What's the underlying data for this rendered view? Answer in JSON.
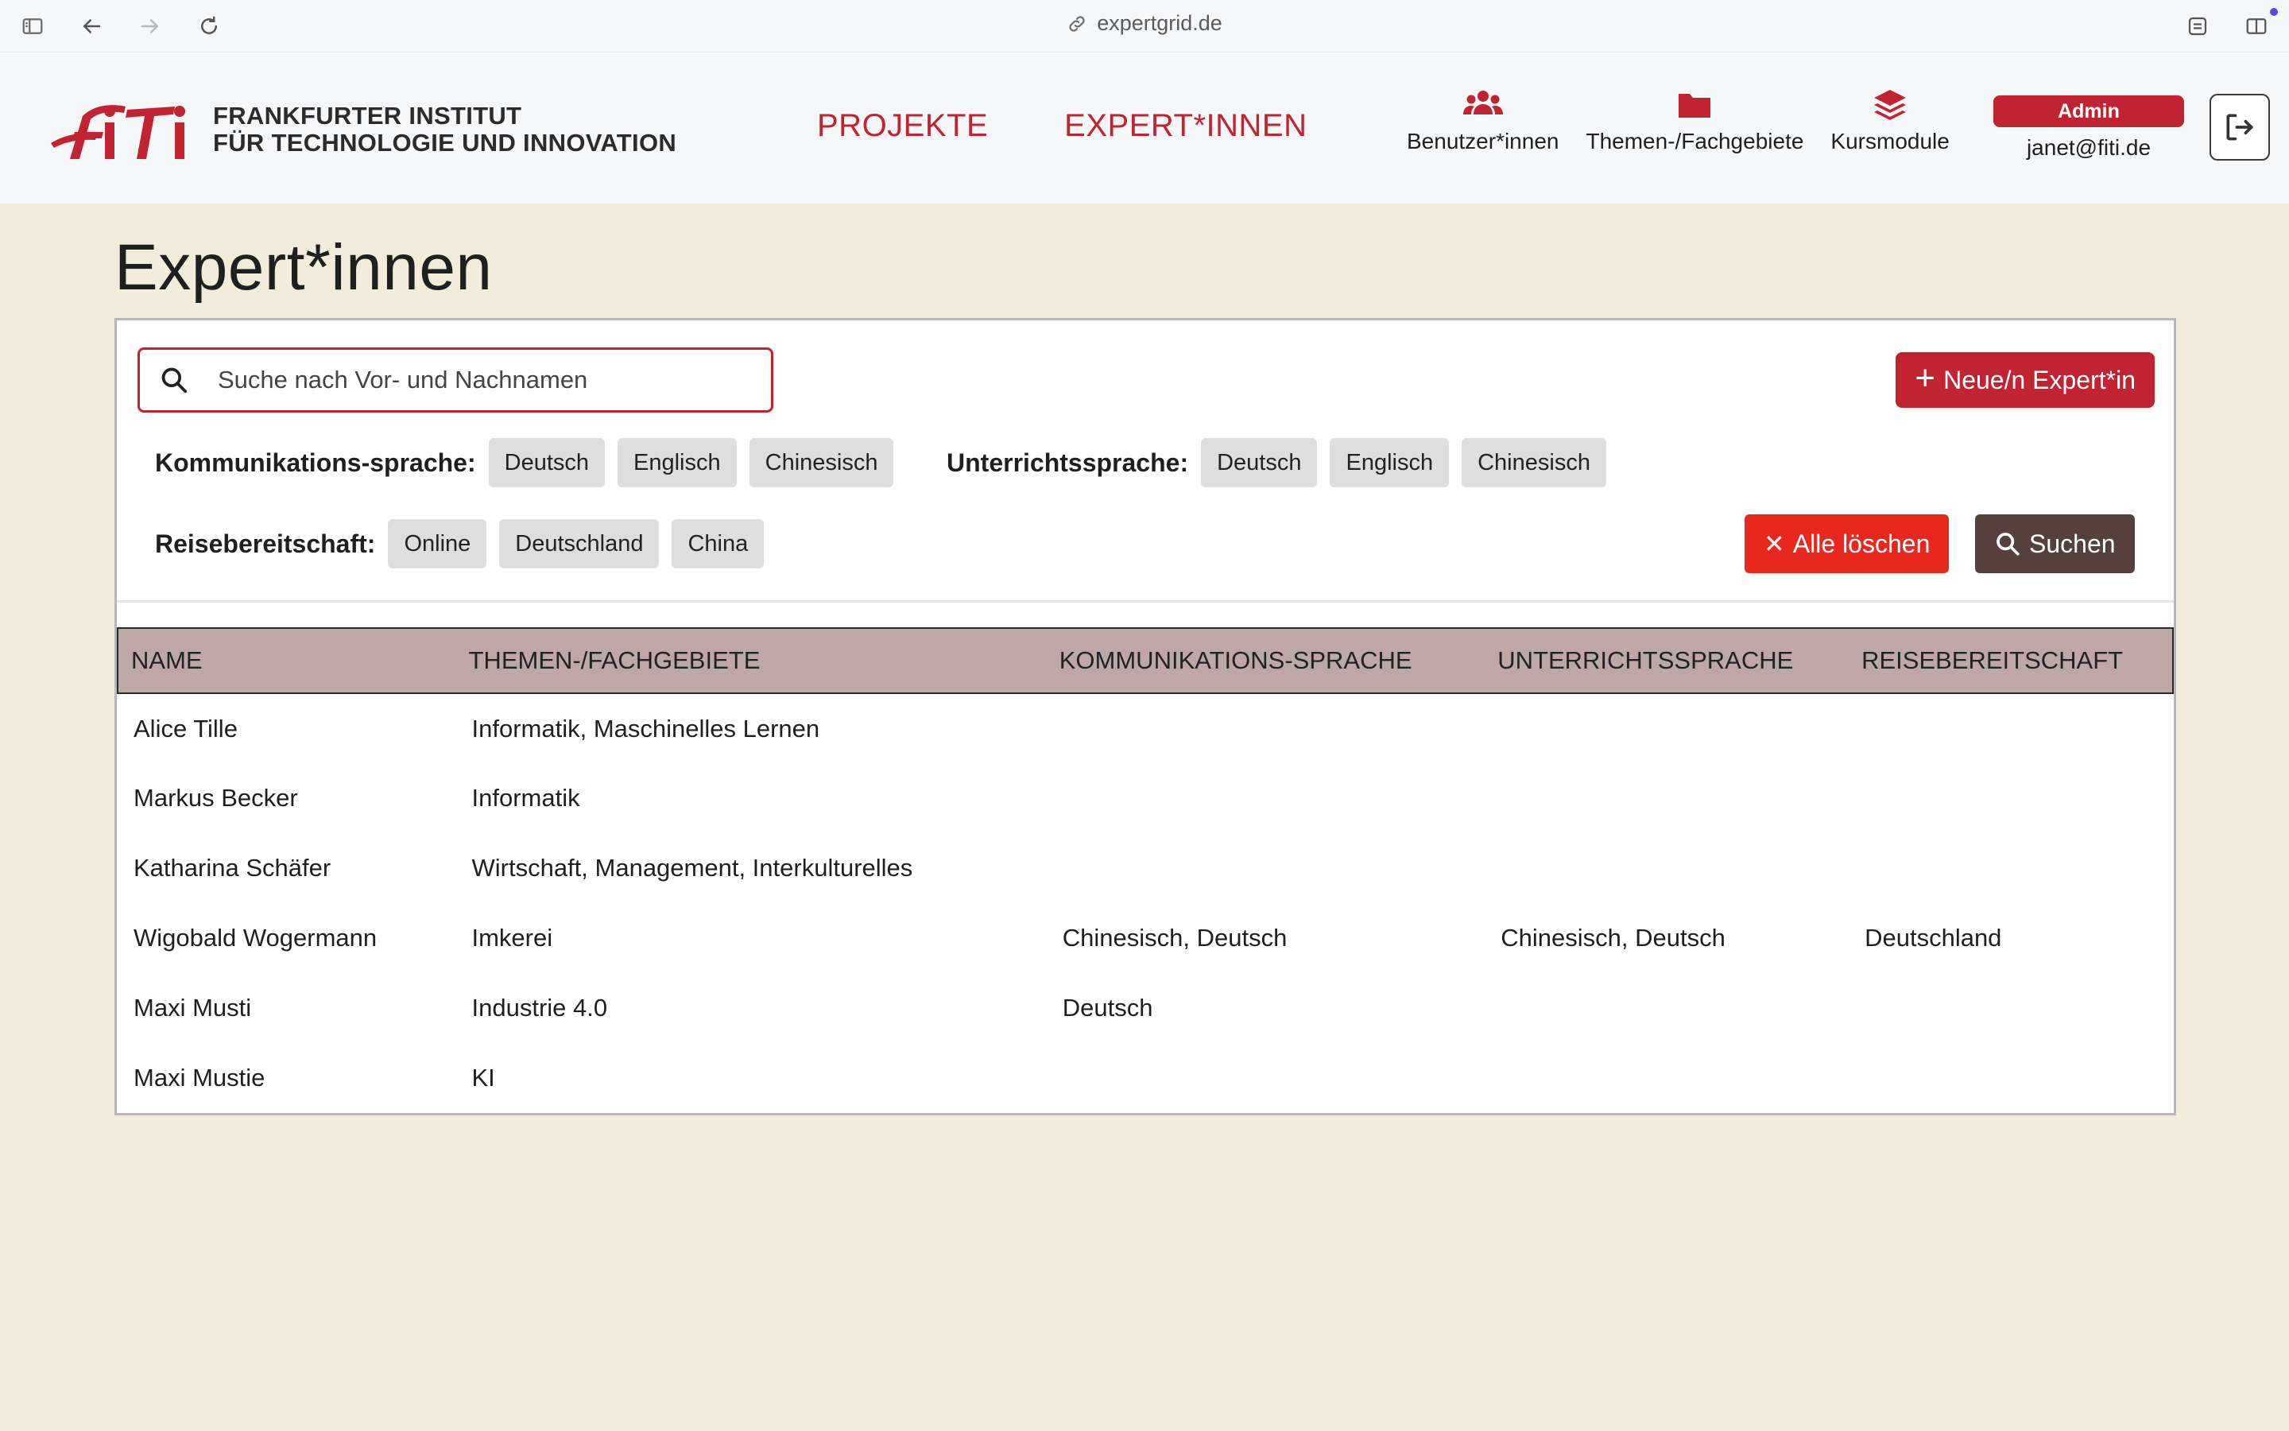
{
  "browser": {
    "url": "expertgrid.de"
  },
  "logo": {
    "line1": "FRANKFURTER INSTITUT",
    "line2": "FÜR TECHNOLOGIE UND INNOVATION"
  },
  "nav": {
    "projects": "PROJEKTE",
    "experts": "EXPERT*INNEN"
  },
  "admin_nav": {
    "users": "Benutzer*innen",
    "topics": "Themen-/Fachgebiete",
    "courses": "Kursmodule"
  },
  "user": {
    "role": "Admin",
    "email": "janet@fiti.de"
  },
  "page": {
    "title": "Expert*innen"
  },
  "search": {
    "placeholder": "Suche nach Vor- und Nachnamen",
    "value": ""
  },
  "buttons": {
    "new_expert": "Neue/n Expert*in",
    "clear_all": "Alle löschen",
    "search": "Suchen"
  },
  "filters": {
    "communication": {
      "label": "Kommunikations-sprache:",
      "options": [
        "Deutsch",
        "Englisch",
        "Chinesisch"
      ]
    },
    "teaching": {
      "label": "Unterrichtssprache:",
      "options": [
        "Deutsch",
        "Englisch",
        "Chinesisch"
      ]
    },
    "travel": {
      "label": "Reisebereitschaft:",
      "options": [
        "Online",
        "Deutschland",
        "China"
      ]
    }
  },
  "table": {
    "headers": [
      "NAME",
      "THEMEN-/FACHGEBIETE",
      "KOMMUNIKATIONS-SPRACHE",
      "UNTERRICHTSSPRACHE",
      "REISEBEREITSCHAFT"
    ],
    "rows": [
      [
        "Alice Tille",
        "Informatik, Maschinelles Lernen",
        "",
        "",
        ""
      ],
      [
        "Markus Becker",
        "Informatik",
        "",
        "",
        ""
      ],
      [
        "Katharina Schäfer",
        "Wirtschaft, Management, Interkulturelles",
        "",
        "",
        ""
      ],
      [
        "Wigobald Wogermann",
        "Imkerei",
        "Chinesisch, Deutsch",
        "Chinesisch, Deutsch",
        "Deutschland"
      ],
      [
        "Maxi Musti",
        "Industrie 4.0",
        "Deutsch",
        "",
        ""
      ],
      [
        "Maxi Mustie",
        "KI",
        "",
        "",
        ""
      ]
    ]
  },
  "colors": {
    "brand": "#c12331",
    "danger": "#e8281f",
    "search_btn": "#55403c",
    "table_header": "#bda8a5",
    "page_bg": "#f3ecda"
  },
  "icons": [
    "sidebar-icon",
    "back-arrow-icon",
    "forward-arrow-icon",
    "reload-icon",
    "link-icon",
    "reader-icon",
    "split-view-icon",
    "users-icon",
    "folder-icon",
    "layers-icon",
    "logout-icon",
    "search-icon",
    "plus-icon",
    "close-icon"
  ]
}
